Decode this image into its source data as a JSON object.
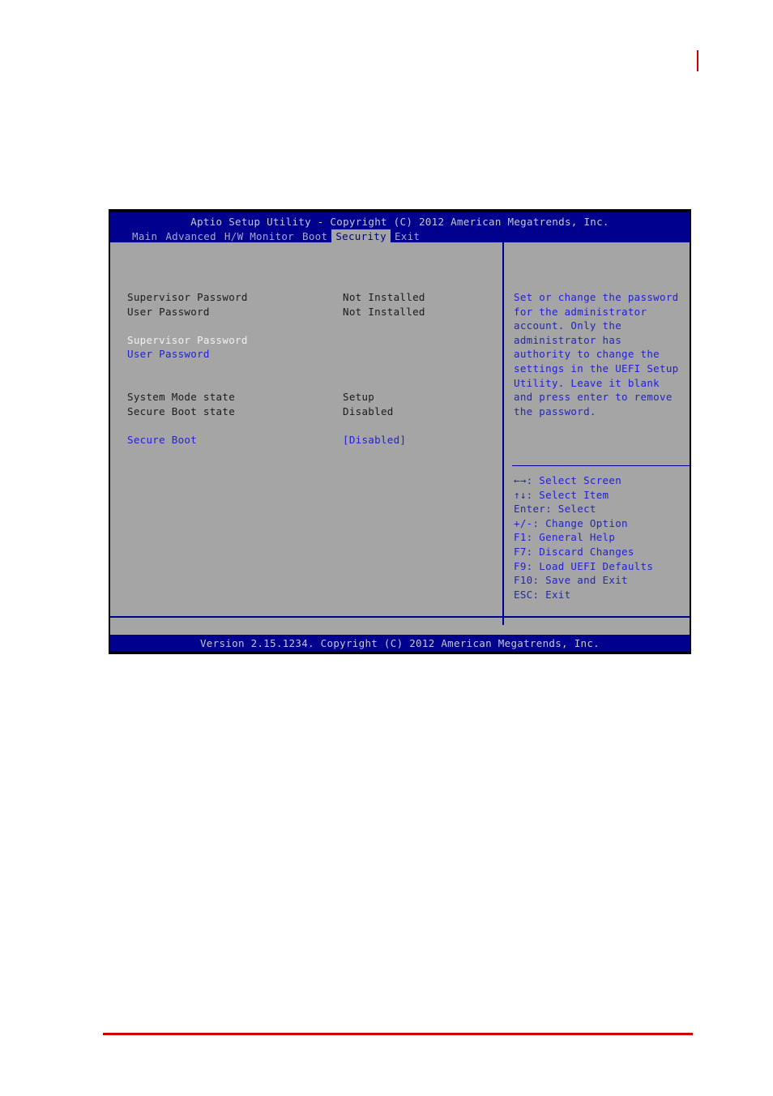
{
  "bios": {
    "title": "Aptio Setup Utility - Copyright (C) 2012 American Megatrends, Inc.",
    "footer": "Version 2.15.1234. Copyright (C) 2012 American Megatrends, Inc.",
    "menu": [
      {
        "label": "Main",
        "active": false
      },
      {
        "label": "Advanced",
        "active": false
      },
      {
        "label": "H/W Monitor",
        "active": false
      },
      {
        "label": "Boot",
        "active": false
      },
      {
        "label": "Security",
        "active": true
      },
      {
        "label": "Exit",
        "active": false
      }
    ],
    "settings": [
      {
        "label": "Supervisor Password",
        "value": "Not Installed",
        "style": "dark"
      },
      {
        "label": "User Password",
        "value": "Not Installed",
        "style": "dark"
      },
      {
        "label": "Supervisor Password",
        "value": "",
        "style": "white"
      },
      {
        "label": "User Password",
        "value": "",
        "style": "blue"
      },
      {
        "label": "System Mode state",
        "value": "Setup",
        "style": "dark"
      },
      {
        "label": "Secure Boot state",
        "value": "Disabled",
        "style": "dark"
      },
      {
        "label": "Secure Boot",
        "value": "[Disabled]",
        "style": "blue"
      }
    ],
    "help_text": "Set or change the password for the administrator account. Only the administrator has authority to change the settings in the UEFI Setup Utility. Leave it blank and press enter to remove the password.",
    "legend": [
      "←→: Select Screen",
      "↑↓: Select Item",
      "Enter: Select",
      "+/-: Change Option",
      "F1: General Help",
      "F7: Discard Changes",
      "F9: Load UEFI Defaults",
      "F10: Save and Exit",
      "ESC: Exit"
    ]
  },
  "colors": {
    "header_blue": "#00008f",
    "panel_gray": "#a5a5a5",
    "highlight_blue": "#2222cc",
    "selected_white": "#f2f2f2",
    "accent_red": "#cc0000"
  }
}
